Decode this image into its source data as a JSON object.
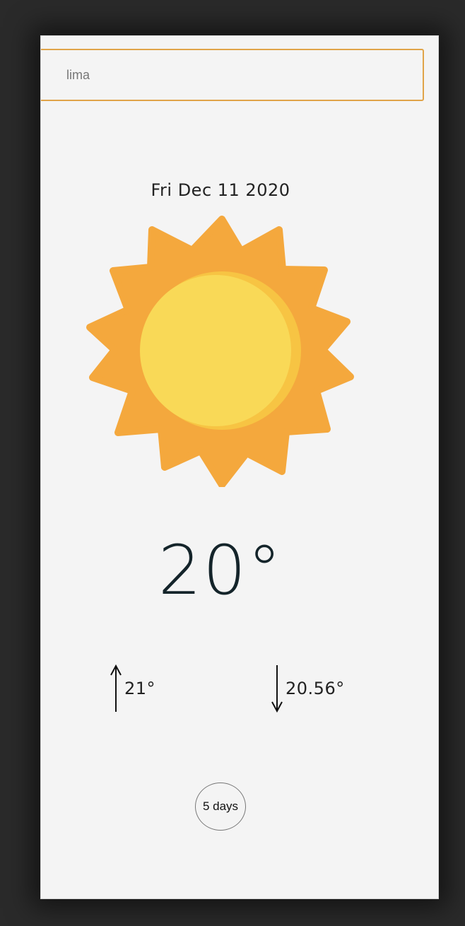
{
  "search": {
    "value": "lima",
    "placeholder": ""
  },
  "weather": {
    "date": "Fri Dec 11 2020",
    "condition_icon": "sun-icon",
    "temperature": "20°",
    "high": "21°",
    "low": "20.56°"
  },
  "forecast_button": {
    "label": "5 days"
  },
  "colors": {
    "accent_border": "#e0a449",
    "sun_rays": "#f4a83d",
    "sun_core": "#f9d957",
    "background": "#f4f4f4"
  }
}
